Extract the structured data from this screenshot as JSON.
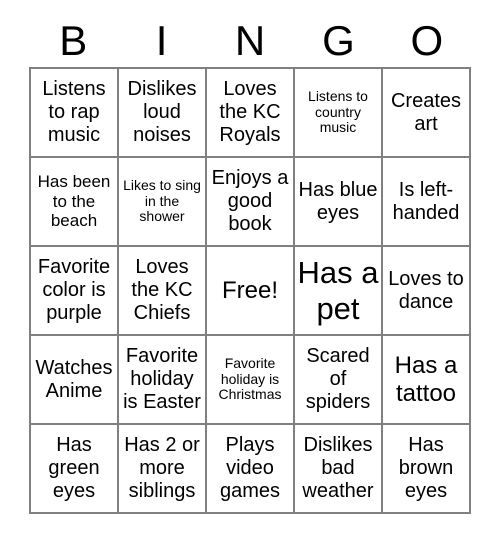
{
  "header": {
    "letters": [
      "B",
      "I",
      "N",
      "G",
      "O"
    ]
  },
  "grid": {
    "rows": [
      [
        {
          "text": "Listens to rap music",
          "size": "m"
        },
        {
          "text": "Dislikes loud noises",
          "size": "m"
        },
        {
          "text": "Loves the KC Royals",
          "size": "m"
        },
        {
          "text": "Listens to country music",
          "size": "xs"
        },
        {
          "text": "Creates art",
          "size": "m"
        }
      ],
      [
        {
          "text": "Has been to the beach",
          "size": "s"
        },
        {
          "text": "Likes to sing in the shower",
          "size": "xs"
        },
        {
          "text": "Enjoys a good book",
          "size": "m"
        },
        {
          "text": "Has blue eyes",
          "size": "m"
        },
        {
          "text": "Is left-handed",
          "size": "m"
        }
      ],
      [
        {
          "text": "Favorite color is purple",
          "size": "m"
        },
        {
          "text": "Loves the KC Chiefs",
          "size": "m"
        },
        {
          "text": "Free!",
          "size": "l"
        },
        {
          "text": "Has a pet",
          "size": "xl"
        },
        {
          "text": "Loves to dance",
          "size": "m"
        }
      ],
      [
        {
          "text": "Watches Anime",
          "size": "m"
        },
        {
          "text": "Favorite holiday is Easter",
          "size": "m"
        },
        {
          "text": "Favorite holiday is Christmas",
          "size": "xs"
        },
        {
          "text": "Scared of spiders",
          "size": "m"
        },
        {
          "text": "Has a tattoo",
          "size": "l"
        }
      ],
      [
        {
          "text": "Has green eyes",
          "size": "m"
        },
        {
          "text": "Has 2 or more siblings",
          "size": "m"
        },
        {
          "text": "Plays video games",
          "size": "m"
        },
        {
          "text": "Dislikes bad weather",
          "size": "m"
        },
        {
          "text": "Has brown eyes",
          "size": "m"
        }
      ]
    ]
  },
  "colors": {
    "background": "#ffffff",
    "text": "#000000",
    "grid_line": "#808080"
  }
}
